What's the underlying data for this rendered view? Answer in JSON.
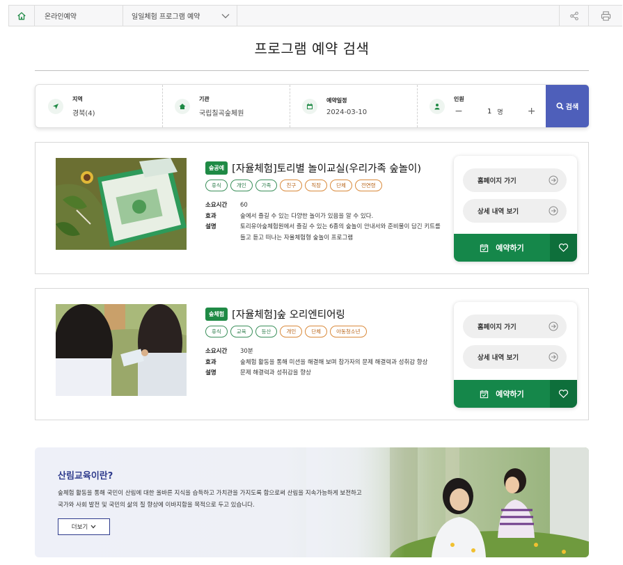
{
  "breadcrumb": {
    "items": [
      "온라인예약",
      "일일체험 프로그램 예약"
    ]
  },
  "page": {
    "title": "프로그램 예약 검색"
  },
  "search": {
    "region": {
      "label": "지역",
      "value": "경북(4)"
    },
    "facility": {
      "label": "기관",
      "value": "국립칠곡숲체원"
    },
    "date": {
      "label": "예약일정",
      "value": "2024-03-10"
    },
    "people": {
      "label": "인원",
      "minus": "−",
      "count": "1",
      "unit": "명",
      "plus": "+"
    },
    "button_label": "검색"
  },
  "programs": [
    {
      "badge": "숲공예",
      "title": "[자율체험]토리별 놀이교실(우리가족 숲놀이)",
      "tags": [
        "휴식",
        "개인",
        "가족",
        "친구",
        "직장",
        "단체",
        "전연령"
      ],
      "duration_label": "소요시간",
      "duration": "60",
      "effect_label": "효과",
      "effect": "숲에서 즐길 수 있는 다양한 놀이가 있음을 알 수 있다.",
      "desc_label": "설명",
      "desc": "토리유아숲체험원에서 즐길 수 있는 6종의 숲놀이 안내서와 준비물이 담긴 키트를 들고 듣고 떠나는 자율체험형 숲놀이 프로그램"
    },
    {
      "badge": "숲체험",
      "title": "[자율체험]숲 오리엔티어링",
      "tags": [
        "휴식",
        "교육",
        "등산",
        "개인",
        "단체",
        "아동청소년"
      ],
      "duration_label": "소요시간",
      "duration": "30분",
      "effect_label": "효과",
      "effect": "숲체험 활동을 통해 미션을 해결해 보며 참가자의 문제 해결력과 성취감 향상",
      "desc_label": "설명",
      "desc": "문제 해결력과 성취감을 향상"
    }
  ],
  "actions": {
    "homepage": "홈페이지 가기",
    "detail": "상세 내역 보기",
    "reserve": "예약하기"
  },
  "banner": {
    "title": "산림교육이란?",
    "desc": "숲체험 활동을 통해 국민이 산림에 대한 올바른 지식을 습득하고 가치관을 가지도록 함으로써 산림을 지속가능하게 보전하고 국가와 사회 발전 및 국민의 삶의 질 향상에 이바지함을 목적으로 두고 있습니다.",
    "more_label": "더보기"
  },
  "colors": {
    "green": "#15874a",
    "search_button": "#4e5fba",
    "banner_title": "#2d3a8c",
    "tag_green": "#3a8f5a",
    "tag_orange": "#d9893a"
  },
  "icons": [
    "home-icon",
    "chevron-down-icon",
    "share-icon",
    "print-icon",
    "location-arrow-icon",
    "building-icon",
    "calendar-icon",
    "person-icon",
    "search-icon",
    "arrow-right-circle-icon",
    "calendar-check-icon",
    "heart-icon"
  ]
}
